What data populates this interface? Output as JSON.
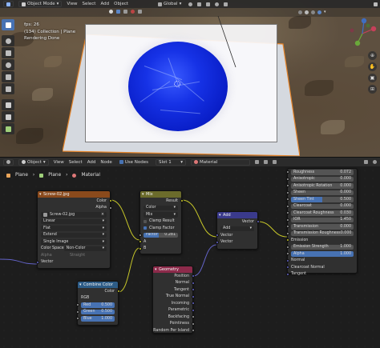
{
  "viewport": {
    "mode_label": "Object Mode",
    "menu": [
      "View",
      "Select",
      "Add",
      "Object"
    ],
    "transform_orientation": "Global",
    "overlay_lines": [
      "fps: 26",
      "(134) Collection | Plane",
      "Rendering Done"
    ]
  },
  "node_editor": {
    "header": {
      "mode_label": "Object",
      "menu": [
        "View",
        "Select",
        "Add",
        "Node"
      ],
      "use_nodes_label": "Use Nodes",
      "slot_label": "Slot 1",
      "material_name": "Material"
    },
    "breadcrumb": [
      "Plane",
      "Plane",
      "Material"
    ]
  },
  "nodes": {
    "image_texture": {
      "title": "Screw-02.jpg",
      "outputs": [
        "Color",
        "Alpha"
      ],
      "image_name": "Screw-02.jpg",
      "interpolation": "Linear",
      "projection": "Flat",
      "extension": "Extend",
      "source": "Single Image",
      "color_space_label": "Color Space",
      "color_space": "Non-Color",
      "alpha_label": "Alpha",
      "alpha_value": "Straight",
      "input": "Vector"
    },
    "mix": {
      "title": "Mix",
      "output": "Result",
      "data_type": "Color",
      "blend_type": "Mix",
      "clamp_result": "Clamp Result",
      "clamp_factor": "Clamp Factor",
      "factor_label": "Factor",
      "factor_value": "0.281",
      "inputs": [
        "A",
        "B"
      ]
    },
    "vector_add": {
      "title": "Add",
      "output": "Vector",
      "operation": "Add",
      "inputs": [
        "Vector",
        "Vector"
      ]
    },
    "combine_color": {
      "title": "Combine Color",
      "output": "Color",
      "mode": "RGB",
      "red_label": "Red",
      "red_value": "0.500",
      "green_label": "Green",
      "green_value": "0.500",
      "blue_label": "Blue",
      "blue_value": "1.000"
    },
    "geometry": {
      "title": "Geometry",
      "outputs": [
        "Position",
        "Normal",
        "Tangent",
        "True Normal",
        "Incoming",
        "Parametric",
        "Backfacing",
        "Pointiness",
        "Random Per Island"
      ]
    },
    "principled": {
      "rows": [
        {
          "label": "Roughness",
          "value": "0.072"
        },
        {
          "label": "Anisotropic",
          "value": "0.000"
        },
        {
          "label": "Anisotropic Rotation",
          "value": "0.000"
        },
        {
          "label": "Sheen",
          "value": "0.000"
        },
        {
          "label": "Sheen Tint",
          "value": "0.500"
        },
        {
          "label": "Clearcoat",
          "value": "0.000"
        },
        {
          "label": "Clearcoat Roughness",
          "value": "0.030"
        },
        {
          "label": "IOR",
          "value": "1.450"
        },
        {
          "label": "Transmission",
          "value": "0.000"
        },
        {
          "label": "Transmission Roughness",
          "value": "0.000"
        }
      ],
      "emission_label": "Emission",
      "emission_strength_label": "Emission Strength",
      "emission_strength_value": "1.000",
      "alpha_label": "Alpha",
      "alpha_value": "1.000",
      "inputs_bottom": [
        "Normal",
        "Clearcoat Normal",
        "Tangent"
      ]
    }
  },
  "colors": {
    "texture_header": "#8a4a1c",
    "converter_header": "#2d5c87",
    "mix_header": "#6b6b2b",
    "vector_header": "#3a3a8c",
    "input_header": "#8c2a4a",
    "accent": "#4772b3"
  }
}
